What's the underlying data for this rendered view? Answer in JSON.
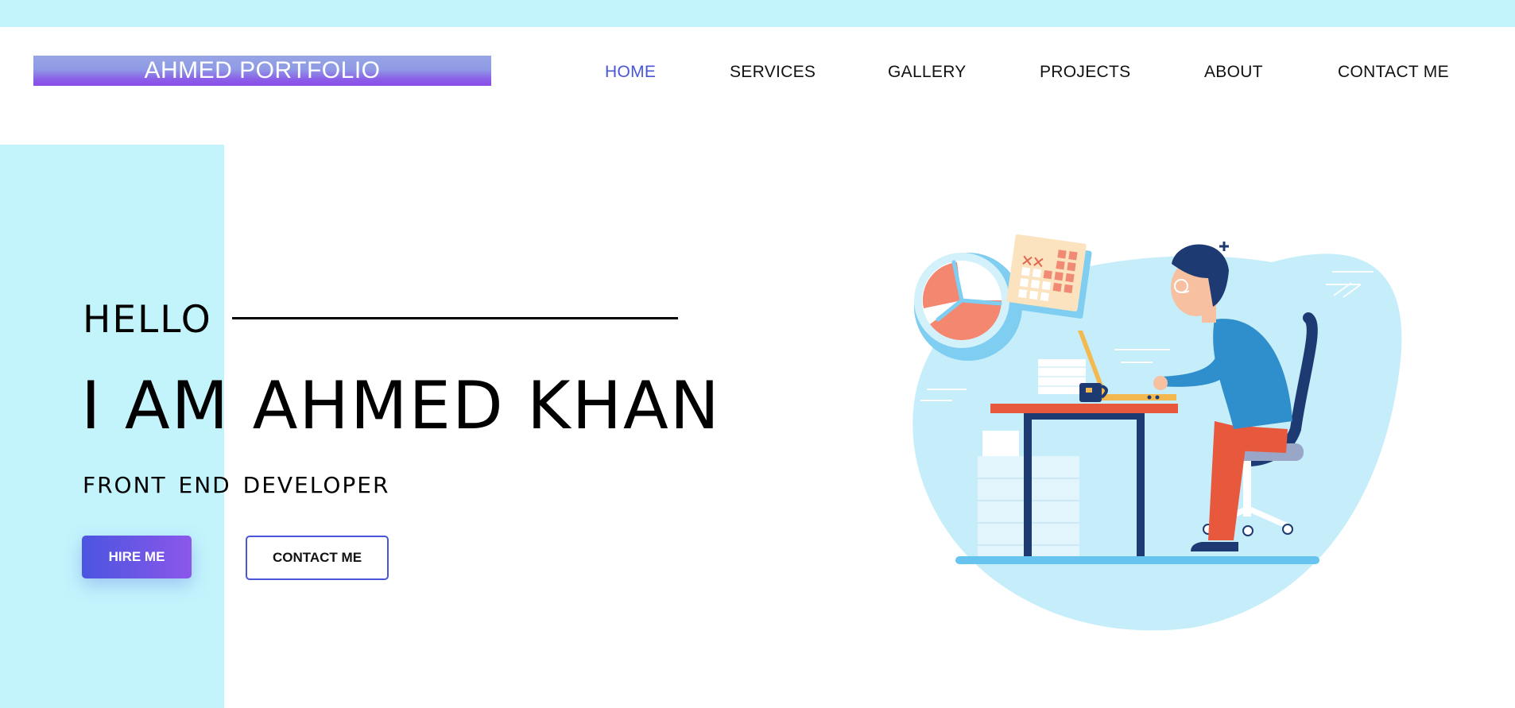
{
  "header": {
    "logo_text": "AHMED PORTFOLIO",
    "nav": [
      {
        "label": "HOME",
        "active": true
      },
      {
        "label": "SERVICES",
        "active": false
      },
      {
        "label": "GALLERY",
        "active": false
      },
      {
        "label": "PROJECTS",
        "active": false
      },
      {
        "label": "ABOUT",
        "active": false
      },
      {
        "label": "CONTACT ME",
        "active": false
      }
    ]
  },
  "hero": {
    "greeting": "HELLO",
    "name": "I AM AHMED KHAN",
    "role": "FRONT END DEVELOPER",
    "hire_button": "HIRE ME",
    "contact_button": "CONTACT ME",
    "illustration": "developer-at-desk-illustration"
  },
  "colors": {
    "accent_light_cyan": "#c3f4fc",
    "nav_active": "#4a56d8",
    "button_gradient_start": "#4b55e0",
    "button_gradient_end": "#8b57ea"
  }
}
